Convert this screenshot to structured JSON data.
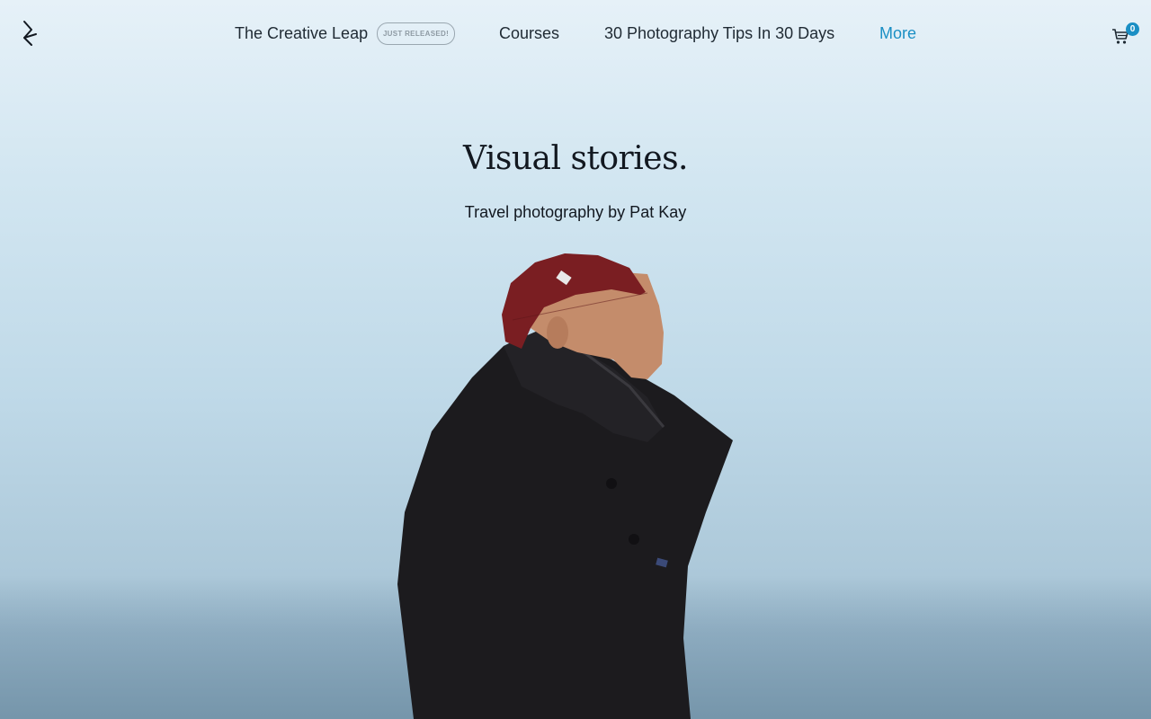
{
  "nav": {
    "links": [
      {
        "label": "The Creative Leap"
      },
      {
        "label": "Courses"
      },
      {
        "label": "30 Photography Tips In 30 Days"
      },
      {
        "label": "More"
      }
    ],
    "badge": "JUST RELEASED!",
    "cart_count": "0",
    "logo_icon": "pk-monogram-icon",
    "cart_icon": "shopping-cart-icon"
  },
  "hero": {
    "title": "Visual stories.",
    "subtitle": "Travel photography by Pat Kay",
    "image": "man-in-red-beanie-and-black-parka-against-misty-sky"
  },
  "colors": {
    "accent": "#1a8fc4",
    "text": "#1f2a33",
    "hat": "#7a1e22",
    "jacket": "#1c1b1e",
    "sky": "#d2e6f1"
  }
}
